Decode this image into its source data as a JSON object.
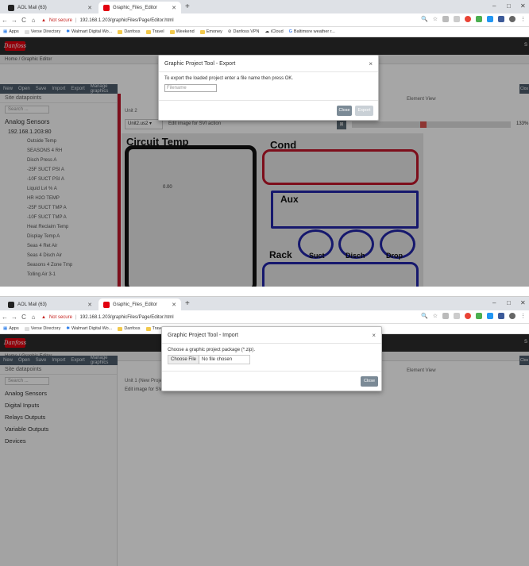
{
  "browser": {
    "tabs": [
      "AOL Mail (63)",
      "Graphic_Files_Editor"
    ],
    "new_tab_symbol": "+",
    "window_controls": [
      "–",
      "□",
      "✕"
    ],
    "nav": [
      "←",
      "→",
      "C",
      "⌂"
    ],
    "not_secure_label": "Not secure",
    "url": "192.168.1.203/graphicFiles/Page/Editor.html",
    "bookmarks": [
      "Apps",
      "Verse Directory",
      "Walmart Digital Wo...",
      "Danfoss",
      "Travel",
      "Weekend",
      "Emoney",
      "Danfoss VPN",
      "iCloud",
      "Baltimore weather r..."
    ]
  },
  "app": {
    "logo": "Danfoss",
    "breadcrumb": "Home / Graphic Editor",
    "toolbar": [
      "New",
      "Open",
      "Save",
      "Import",
      "Export",
      "Manage graphics"
    ],
    "right_button": "Clos",
    "sidebar_title": "Site datapoints",
    "search_placeholder": "Search ...",
    "sidebar_header": "Analog Sensors",
    "site_ip": "192.168.1.203:80",
    "analog_items": [
      "Outside Temp",
      "SEASONS 4 RH",
      "Disch Press A",
      "-25F SUCT PSI A",
      "-10F SUCT PSI A",
      "Liquid Lvl % A",
      "HR H2O TEMP",
      "-25F SUCT TMP A",
      "-10F SUCT TMP A",
      "Heat Reclaim Temp",
      "Display Temp A",
      "Seas 4 Ret Air",
      "Seas 4 Disch Air",
      "Seasons 4 Zone Tmp",
      "Tolling Air 3-1"
    ],
    "sidebar_categories": [
      "Analog Sensors",
      "Digital Inputs",
      "Relays Outputs",
      "Variable Outputs",
      "Devices"
    ],
    "screen_one": {
      "tab_label": "Unit 2",
      "dropdown": "Unit2.us2 ▾",
      "edit_label": "Edit image for SVI action",
      "element_view": "Element View",
      "zoom": "133%",
      "canvas_labels": [
        "Circuit Temp",
        "Cond",
        "Aux",
        "Rack",
        "Suct",
        "Disch",
        "Drop"
      ],
      "canvas_value": "0.00"
    },
    "screen_two": {
      "tab_label": "Unit 1 (New Project)",
      "edit_label": "Edit image for SVI action",
      "element_view": "Element View"
    }
  },
  "export_dialog": {
    "title": "Graphic Project Tool - Export",
    "close_x": "×",
    "instruction": "To export the loaded project enter a file name then press OK.",
    "input_placeholder": "Filename",
    "close_button": "Close",
    "export_button": "Export"
  },
  "import_dialog": {
    "title": "Graphic Project Tool - Import",
    "close_x": "×",
    "instruction": "Choose a graphic project package (*.zip).",
    "choose_file": "Choose File",
    "no_file": "No file chosen",
    "close_button": "Close"
  },
  "colors": {
    "appbar": "#2b2b2b",
    "toolbar": "#4e5d6c",
    "accent_red": "#c0162a",
    "accent_blue": "#2326a8"
  }
}
